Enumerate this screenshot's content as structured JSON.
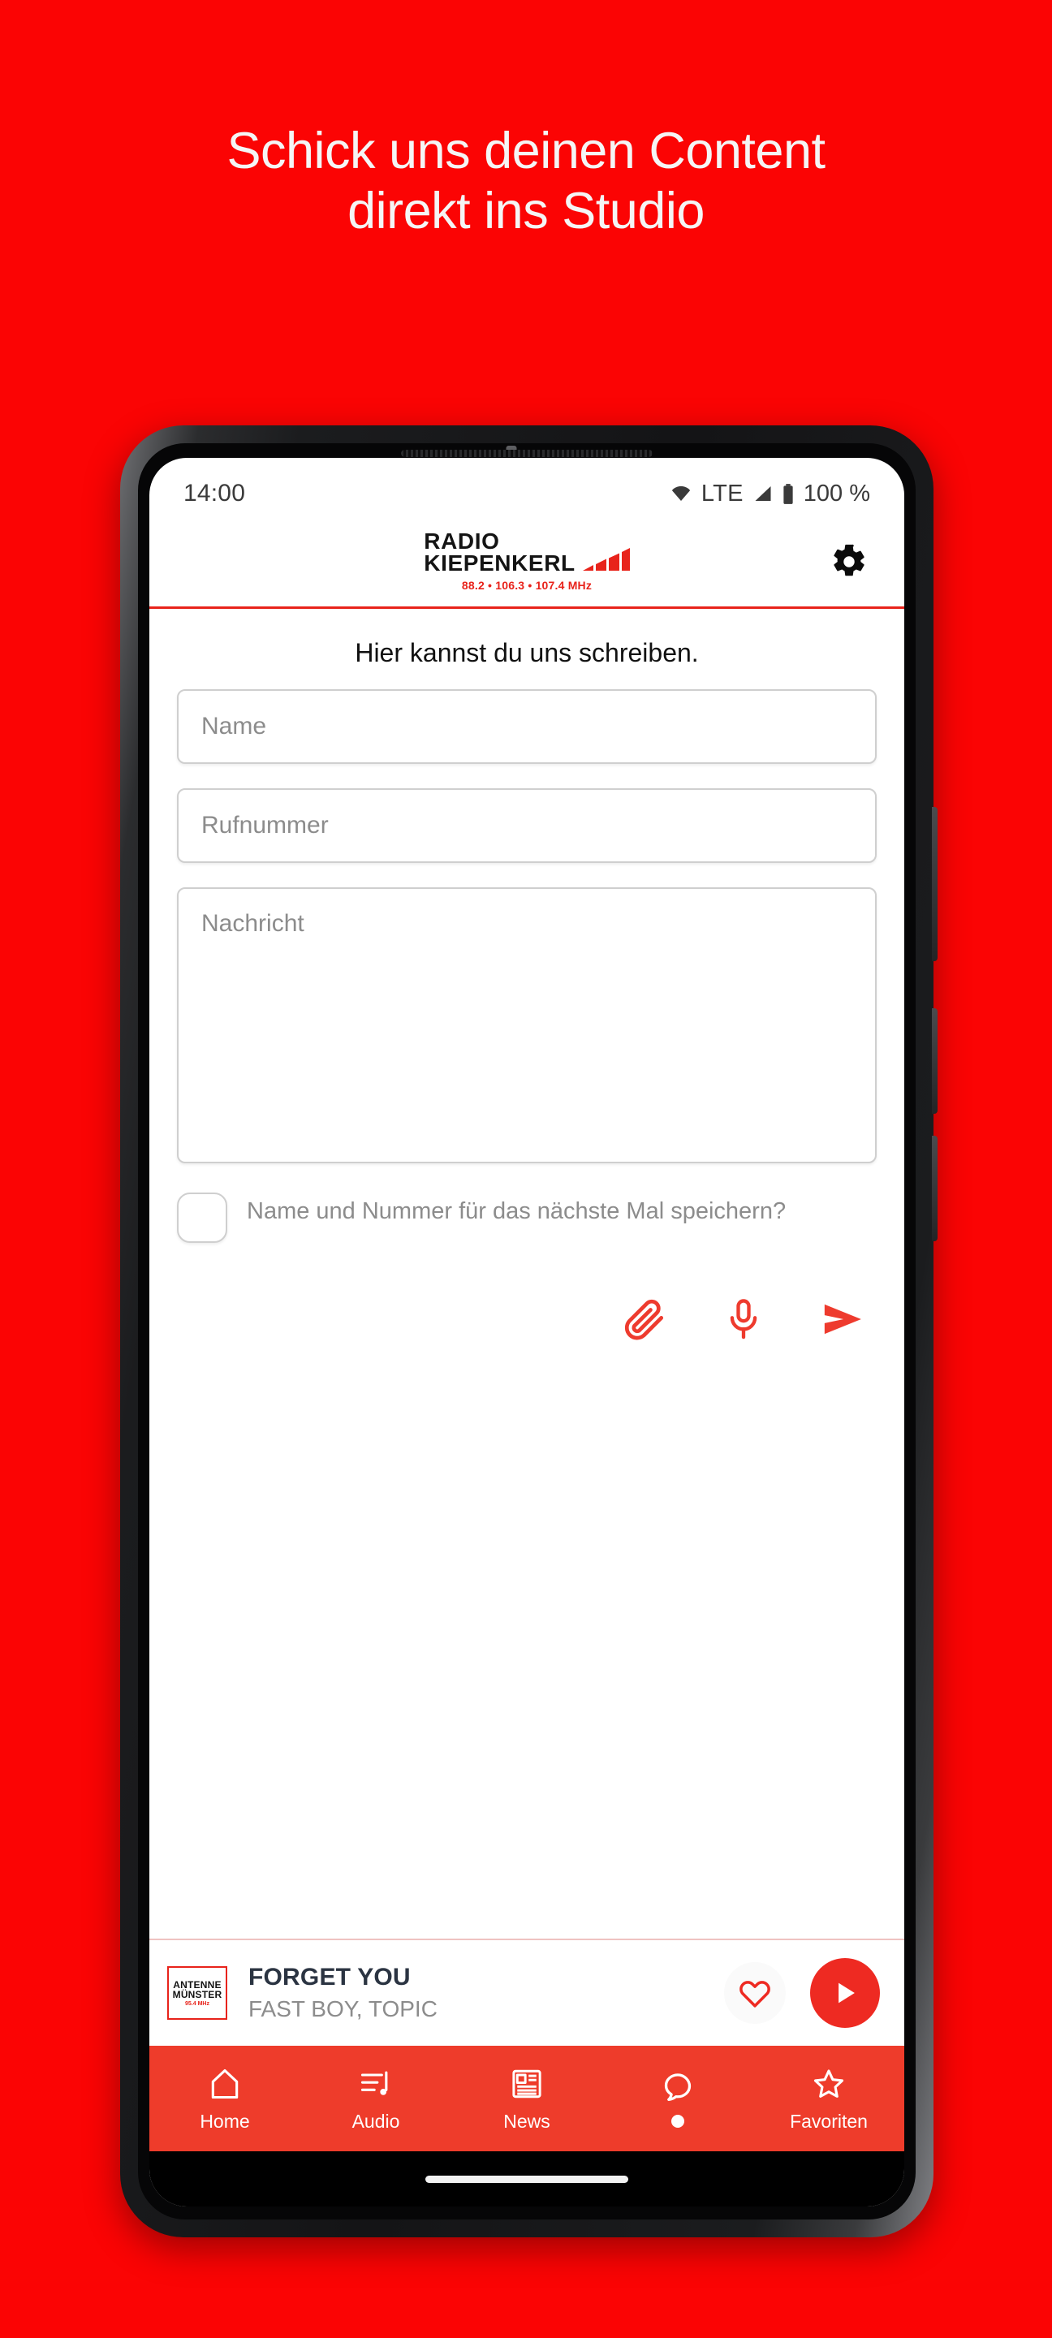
{
  "promo": {
    "headline_line1": "Schick uns deinen Content",
    "headline_line2": "direkt ins Studio",
    "background_color": "#FB0404",
    "text_color": "#F5F5F5"
  },
  "status_bar": {
    "time": "14:00",
    "network": "LTE",
    "battery": "100 %",
    "icons": [
      "wifi-icon",
      "signal-icon",
      "battery-icon"
    ]
  },
  "app_header": {
    "brand_line1": "RADIO",
    "brand_line2": "KIEPENKERL",
    "frequencies": "88.2 • 106.3 • 107.4 MHz",
    "settings_icon": "gear-icon",
    "accent_color": "#E8231B"
  },
  "form": {
    "title": "Hier kannst du uns schreiben.",
    "fields": [
      {
        "name": "name",
        "placeholder": "Name",
        "value": ""
      },
      {
        "name": "phone",
        "placeholder": "Rufnummer",
        "value": ""
      },
      {
        "name": "message",
        "placeholder": "Nachricht",
        "value": ""
      }
    ],
    "save_checkbox": {
      "label": "Name und Nummer für das nächste Mal speichern?",
      "checked": false
    },
    "actions": [
      {
        "name": "attach",
        "icon": "paperclip-icon"
      },
      {
        "name": "voice",
        "icon": "microphone-icon"
      },
      {
        "name": "send",
        "icon": "send-icon"
      }
    ],
    "action_color": "#EE3B2E"
  },
  "player": {
    "artwork_line1": "ANTENNE",
    "artwork_line2": "MÜNSTER",
    "artwork_line3": "95.4 MHz",
    "track_title": "FORGET YOU",
    "track_artist": "FAST BOY, TOPIC",
    "favorite_icon": "heart-icon",
    "play_icon": "play-icon",
    "play_color": "#EE2A22"
  },
  "bottom_nav": {
    "background_color": "#EE3C2B",
    "items": [
      {
        "label": "Home",
        "icon": "home-icon",
        "active": false
      },
      {
        "label": "Audio",
        "icon": "playlist-icon",
        "active": false
      },
      {
        "label": "News",
        "icon": "news-icon",
        "active": false
      },
      {
        "label": "",
        "icon": "chat-icon",
        "active": true
      },
      {
        "label": "Favoriten",
        "icon": "star-icon",
        "active": false
      }
    ]
  }
}
